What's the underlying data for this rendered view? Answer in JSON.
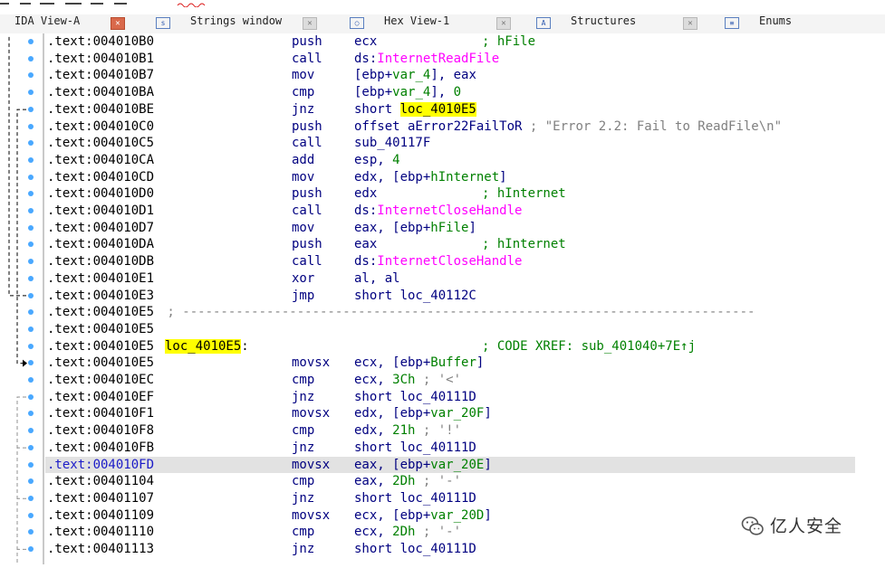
{
  "tabs": [
    {
      "label": "IDA View-A",
      "icon": "ida-view-icon",
      "active": true
    },
    {
      "label": "Strings window",
      "icon": "strings-icon"
    },
    {
      "label": "Hex View-1",
      "icon": "hex-view-icon"
    },
    {
      "label": "Structures",
      "icon": "structures-icon"
    },
    {
      "label": "Enums",
      "icon": "enums-icon"
    }
  ],
  "listing": [
    {
      "addr": ".text:004010B0",
      "mn": "push",
      "ops": [
        {
          "t": "ecx"
        }
      ],
      "cmt": [
        {
          "t": "; hFile",
          "c": "green"
        }
      ]
    },
    {
      "addr": ".text:004010B1",
      "mn": "call",
      "ops": [
        {
          "t": "ds:"
        },
        {
          "t": "InternetReadFile",
          "c": "imp"
        }
      ]
    },
    {
      "addr": ".text:004010B7",
      "mn": "mov",
      "ops": [
        {
          "t": "[ebp+"
        },
        {
          "t": "var_4",
          "c": "green"
        },
        {
          "t": "], eax"
        }
      ]
    },
    {
      "addr": ".text:004010BA",
      "mn": "cmp",
      "ops": [
        {
          "t": "[ebp+"
        },
        {
          "t": "var_4",
          "c": "green"
        },
        {
          "t": "], "
        },
        {
          "t": "0",
          "c": "green"
        }
      ]
    },
    {
      "addr": ".text:004010BE",
      "mn": "jnz",
      "ops": [
        {
          "t": "short "
        },
        {
          "t": "loc_4010E5",
          "c": "hl"
        }
      ]
    },
    {
      "addr": ".text:004010C0",
      "mn": "push",
      "ops": [
        {
          "t": "offset aError22FailToR "
        }
      ],
      "cmt": [
        {
          "t": "; \"Error 2.2: Fail to ReadFile\\n\"",
          "c": "cmt"
        }
      ]
    },
    {
      "addr": ".text:004010C5",
      "mn": "call",
      "ops": [
        {
          "t": "sub_40117F"
        }
      ]
    },
    {
      "addr": ".text:004010CA",
      "mn": "add",
      "ops": [
        {
          "t": "esp, "
        },
        {
          "t": "4",
          "c": "green"
        }
      ]
    },
    {
      "addr": ".text:004010CD",
      "mn": "mov",
      "ops": [
        {
          "t": "edx, [ebp+"
        },
        {
          "t": "hInternet",
          "c": "green"
        },
        {
          "t": "]"
        }
      ]
    },
    {
      "addr": ".text:004010D0",
      "mn": "push",
      "ops": [
        {
          "t": "edx"
        }
      ],
      "cmt": [
        {
          "t": "; hInternet",
          "c": "green"
        }
      ]
    },
    {
      "addr": ".text:004010D1",
      "mn": "call",
      "ops": [
        {
          "t": "ds:"
        },
        {
          "t": "InternetCloseHandle",
          "c": "imp"
        }
      ]
    },
    {
      "addr": ".text:004010D7",
      "mn": "mov",
      "ops": [
        {
          "t": "eax, [ebp+"
        },
        {
          "t": "hFile",
          "c": "green"
        },
        {
          "t": "]"
        }
      ]
    },
    {
      "addr": ".text:004010DA",
      "mn": "push",
      "ops": [
        {
          "t": "eax"
        }
      ],
      "cmt": [
        {
          "t": "; hInternet",
          "c": "green"
        }
      ]
    },
    {
      "addr": ".text:004010DB",
      "mn": "call",
      "ops": [
        {
          "t": "ds:"
        },
        {
          "t": "InternetCloseHandle",
          "c": "imp"
        }
      ]
    },
    {
      "addr": ".text:004010E1",
      "mn": "xor",
      "ops": [
        {
          "t": "al, al"
        }
      ]
    },
    {
      "addr": ".text:004010E3",
      "mn": "jmp",
      "ops": [
        {
          "t": "short loc_40112C"
        }
      ]
    },
    {
      "addr": ".text:004010E5",
      "sep": " ; ---------------------------------------------------------------------------"
    },
    {
      "addr": ".text:004010E5"
    },
    {
      "addr": ".text:004010E5",
      "label": "loc_4010E5",
      "label_suffix": ":",
      "xref": "; CODE XREF: sub_401040+7E↑j"
    },
    {
      "addr": ".text:004010E5",
      "mn": "movsx",
      "ops": [
        {
          "t": "ecx, [ebp+"
        },
        {
          "t": "Buffer",
          "c": "green"
        },
        {
          "t": "]"
        }
      ]
    },
    {
      "addr": ".text:004010EC",
      "mn": "cmp",
      "ops": [
        {
          "t": "ecx, "
        },
        {
          "t": "3Ch",
          "c": "green"
        }
      ],
      "cmt": [
        {
          "t": " ; '<'",
          "c": "cmt"
        }
      ]
    },
    {
      "addr": ".text:004010EF",
      "mn": "jnz",
      "ops": [
        {
          "t": "short loc_40111D"
        }
      ]
    },
    {
      "addr": ".text:004010F1",
      "mn": "movsx",
      "ops": [
        {
          "t": "edx, [ebp+"
        },
        {
          "t": "var_20F",
          "c": "green"
        },
        {
          "t": "]"
        }
      ]
    },
    {
      "addr": ".text:004010F8",
      "mn": "cmp",
      "ops": [
        {
          "t": "edx, "
        },
        {
          "t": "21h",
          "c": "green"
        }
      ],
      "cmt": [
        {
          "t": " ; '!'",
          "c": "cmt"
        }
      ]
    },
    {
      "addr": ".text:004010FB",
      "mn": "jnz",
      "ops": [
        {
          "t": "short loc_40111D"
        }
      ]
    },
    {
      "addr": ".text:004010FD",
      "mn": "movsx",
      "ops": [
        {
          "t": "eax, [ebp+"
        },
        {
          "t": "var_20E",
          "c": "green"
        },
        {
          "t": "]"
        }
      ],
      "selected": true
    },
    {
      "addr": ".text:00401104",
      "mn": "cmp",
      "ops": [
        {
          "t": "eax, "
        },
        {
          "t": "2Dh",
          "c": "green"
        }
      ],
      "cmt": [
        {
          "t": " ; '-'",
          "c": "cmt"
        }
      ]
    },
    {
      "addr": ".text:00401107",
      "mn": "jnz",
      "ops": [
        {
          "t": "short loc_40111D"
        }
      ]
    },
    {
      "addr": ".text:00401109",
      "mn": "movsx",
      "ops": [
        {
          "t": "ecx, [ebp+"
        },
        {
          "t": "var_20D",
          "c": "green"
        },
        {
          "t": "]"
        }
      ]
    },
    {
      "addr": ".text:00401110",
      "mn": "cmp",
      "ops": [
        {
          "t": "ecx, "
        },
        {
          "t": "2Dh",
          "c": "green"
        }
      ],
      "cmt": [
        {
          "t": " ; '-'",
          "c": "cmt"
        }
      ]
    },
    {
      "addr": ".text:00401113",
      "mn": "jnz",
      "ops": [
        {
          "t": "short loc_40111D"
        }
      ]
    }
  ],
  "watermark": {
    "text": "亿人安全",
    "icon": "wechat-icon"
  },
  "colors": {
    "mnemonic": "#000080",
    "comment": "#808080",
    "variable": "#008000",
    "import": "#ff00ff",
    "highlight": "#ffff00",
    "selected_row": "#e2e2e2",
    "bullet": "#49a8ff"
  }
}
